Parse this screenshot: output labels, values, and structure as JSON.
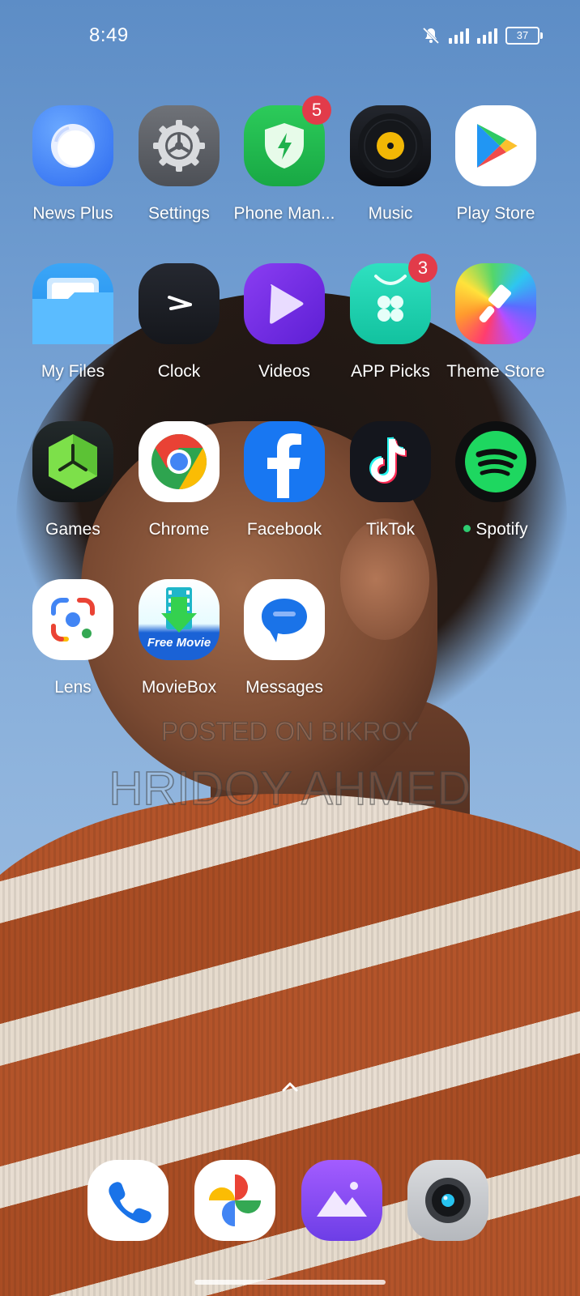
{
  "status_bar": {
    "time": "8:49",
    "battery": "37",
    "icons": [
      "bell-muted-icon",
      "signal-icon",
      "signal-icon",
      "battery-icon"
    ]
  },
  "apps": {
    "row1": [
      {
        "label": "News Plus",
        "icon": "news-plus-icon"
      },
      {
        "label": "Settings",
        "icon": "gear-icon"
      },
      {
        "label": "Phone Man...",
        "icon": "shield-bolt-icon",
        "badge": "5"
      },
      {
        "label": "Music",
        "icon": "vinyl-icon"
      },
      {
        "label": "Play Store",
        "icon": "play-store-icon"
      }
    ],
    "row2": [
      {
        "label": "My Files",
        "icon": "folder-icon"
      },
      {
        "label": "Clock",
        "icon": "clock-icon"
      },
      {
        "label": "Videos",
        "icon": "play-icon"
      },
      {
        "label": "APP Picks",
        "icon": "shopping-bag-icon",
        "badge": "3"
      },
      {
        "label": "Theme Store",
        "icon": "brush-icon"
      }
    ],
    "row3": [
      {
        "label": "Games",
        "icon": "games-hexagon-icon"
      },
      {
        "label": "Chrome",
        "icon": "chrome-icon"
      },
      {
        "label": "Facebook",
        "icon": "facebook-icon"
      },
      {
        "label": "TikTok",
        "icon": "tiktok-icon"
      },
      {
        "label": "Spotify",
        "icon": "spotify-icon"
      }
    ],
    "row4": [
      {
        "label": "Lens",
        "icon": "lens-icon"
      },
      {
        "label": "MovieBox",
        "icon": "moviebox-icon",
        "icon_text": "Free Movie"
      },
      {
        "label": "Messages",
        "icon": "messages-icon"
      }
    ]
  },
  "watermark": {
    "line1": "POSTED ON BIKROY",
    "line2": "HRIDOY AHMED"
  },
  "dock": [
    {
      "icon": "phone-icon"
    },
    {
      "icon": "photos-pinwheel-icon"
    },
    {
      "icon": "gallery-icon"
    },
    {
      "icon": "camera-icon"
    }
  ],
  "colors": {
    "badge": "#e23b4a",
    "spotify_green": "#1ed760",
    "facebook_blue": "#1877f2"
  }
}
